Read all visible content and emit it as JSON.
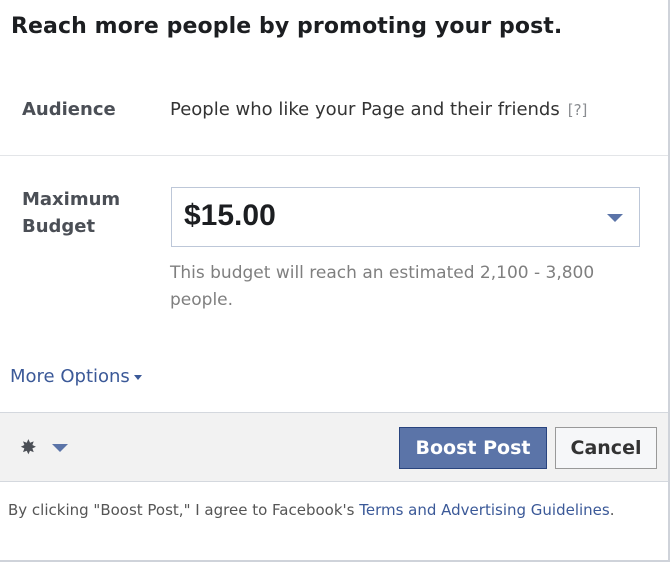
{
  "title": "Reach more people by promoting your post.",
  "audience": {
    "label": "Audience",
    "value": "People who like your Page and their friends",
    "help": "[?]"
  },
  "budget": {
    "label": "Maximum Budget",
    "selected": "$15.00",
    "estimate": "This budget will reach an estimated 2,100 - 3,800 people."
  },
  "more_options": "More Options",
  "footer": {
    "gear_icon": "gear-icon",
    "boost_label": "Boost Post",
    "cancel_label": "Cancel"
  },
  "legal": {
    "prefix": "By clicking \"Boost Post,\" I agree to Facebook's ",
    "link": "Terms and Advertising Guidelines",
    "suffix": "."
  },
  "colors": {
    "primary": "#5b74a8",
    "link": "#3b5998"
  }
}
